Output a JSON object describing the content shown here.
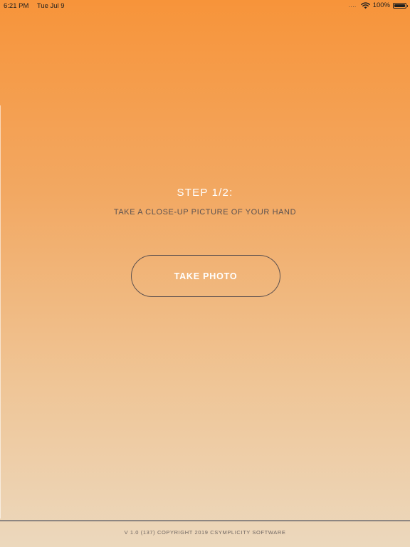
{
  "status_bar": {
    "time": "6:21 PM",
    "date": "Tue Jul 9",
    "signal": "....",
    "battery_percent": "100%",
    "icons": [
      "wifi-icon",
      "battery-icon"
    ]
  },
  "main": {
    "step_title": "STEP 1/2:",
    "step_instruction": "TAKE A CLOSE-UP PICTURE OF YOUR HAND",
    "take_photo_label": "TAKE PHOTO"
  },
  "footer": {
    "copyright": "V 1.0 (137) COPYRIGHT 2019 CSYMPLICITY SOFTWARE"
  },
  "colors": {
    "gradient_top": "#f7943a",
    "gradient_bottom": "#ecd8bd",
    "text_light": "#ffffff",
    "text_dark": "#5a5150",
    "button_border": "#5d514f"
  }
}
